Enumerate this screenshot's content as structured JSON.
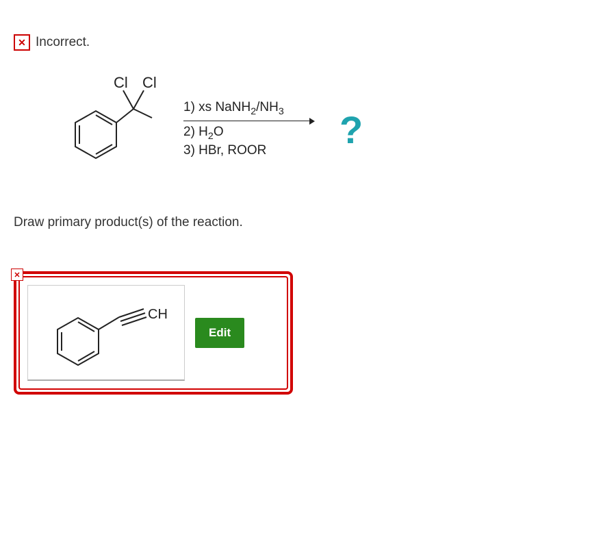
{
  "status": {
    "icon": "x",
    "text": "Incorrect."
  },
  "reaction": {
    "reactant_labels": {
      "cl1": "Cl",
      "cl2": "Cl"
    },
    "conditions": {
      "step1_prefix": "1) xs NaNH",
      "step1_sub1": "2",
      "step1_mid": "/NH",
      "step1_sub2": "3",
      "step2_prefix": "2) H",
      "step2_sub": "2",
      "step2_suffix": "O",
      "step3": "3) HBr, ROOR"
    },
    "product_placeholder": "?"
  },
  "instruction": "Draw primary product(s) of the reaction.",
  "answer": {
    "structure_label": "CH",
    "edit_button": "Edit"
  }
}
